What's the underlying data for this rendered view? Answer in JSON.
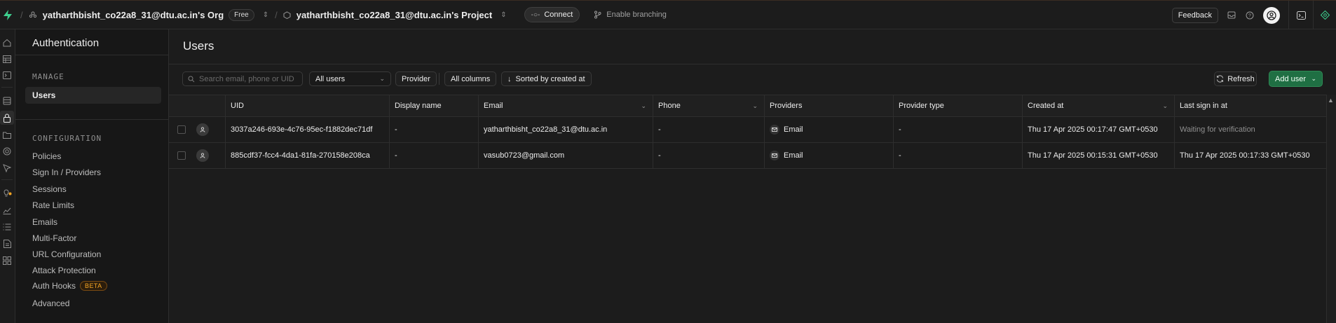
{
  "topbar": {
    "org_name": "yatharthbisht_co22a8_31@dtu.ac.in's Org",
    "plan_badge": "Free",
    "project_name": "yatharthbisht_co22a8_31@dtu.ac.in's Project",
    "connect_label": "Connect",
    "branching_label": "Enable branching",
    "feedback_label": "Feedback"
  },
  "sidebar": {
    "title": "Authentication",
    "manage_heading": "MANAGE",
    "users_label": "Users",
    "configuration_heading": "CONFIGURATION",
    "items": [
      {
        "label": "Policies"
      },
      {
        "label": "Sign In / Providers"
      },
      {
        "label": "Sessions"
      },
      {
        "label": "Rate Limits"
      },
      {
        "label": "Emails"
      },
      {
        "label": "Multi-Factor"
      },
      {
        "label": "URL Configuration"
      },
      {
        "label": "Attack Protection"
      },
      {
        "label": "Auth Hooks",
        "badge": "BETA"
      },
      {
        "label": "Advanced"
      }
    ]
  },
  "main": {
    "title": "Users",
    "search_placeholder": "Search email, phone or UID",
    "user_filter": "All users",
    "provider_btn": "Provider",
    "columns_btn": "All columns",
    "sort_btn": "Sorted by created at",
    "refresh_btn": "Refresh",
    "add_user_btn": "Add user"
  },
  "table": {
    "columns": [
      "UID",
      "Display name",
      "Email",
      "Phone",
      "Providers",
      "Provider type",
      "Created at",
      "Last sign in at"
    ],
    "rows": [
      {
        "uid": "3037a246-693e-4c76-95ec-f1882dec71df",
        "display_name": "-",
        "email": "yatharthbisht_co22a8_31@dtu.ac.in",
        "phone": "-",
        "provider": "Email",
        "provider_type": "-",
        "created_at": "Thu 17 Apr 2025 00:17:47 GMT+0530",
        "last_sign_in": "Waiting for verification"
      },
      {
        "uid": "885cdf37-fcc4-4da1-81fa-270158e208ca",
        "display_name": "-",
        "email": "vasub0723@gmail.com",
        "phone": "-",
        "provider": "Email",
        "provider_type": "-",
        "created_at": "Thu 17 Apr 2025 00:15:31 GMT+0530",
        "last_sign_in": "Thu 17 Apr 2025 00:17:33 GMT+0530"
      }
    ]
  },
  "colors": {
    "accent_green": "#3ecf8e",
    "add_button_bg": "#1f6f43",
    "beta_orange": "#f5a524"
  }
}
